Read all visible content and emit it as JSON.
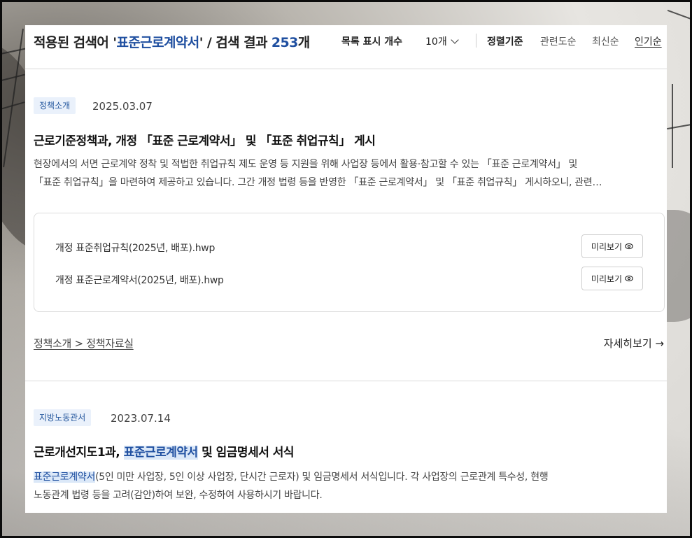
{
  "header": {
    "title_prefix": "적용된 검색어 '",
    "keyword": "표준근로계약서",
    "title_mid": "' / 검색 결과 ",
    "result_count": "253",
    "count_unit": "개",
    "list_count_label": "목록 표시 개수",
    "list_count_value": "10개",
    "sort_label": "정렬기준",
    "sort_options": [
      "관련도순",
      "최신순",
      "인기순"
    ],
    "active_sort": "인기순"
  },
  "results": [
    {
      "category": "정책소개",
      "date": "2025.03.07",
      "title": "근로기준정책과, 개정 「표준 근로계약서」 및 「표준 취업규칙」 게시",
      "summary_line1": "현장에서의 서면 근로계약 정착 및 적법한 취업규칙 제도 운영 등 지원을 위해 사업장 등에서 활용·참고할 수 있는 「표준 근로계약서」 및",
      "summary_line2": "「표준 취업규칙」을 마련하여 제공하고 있습니다. 그간 개정 법령 등을 반영한 「표준 근로계약서」 및 「표준 취업규칙」 게시하오니, 관련…",
      "attachments": [
        {
          "name": "개정 표준취업규칙(2025년, 배포).hwp",
          "button": "미리보기"
        },
        {
          "name": "개정 표준근로계약서(2025년, 배포).hwp",
          "button": "미리보기"
        }
      ],
      "breadcrumb": "정책소개 > 정책자료실",
      "more": "자세히보기 →"
    },
    {
      "category": "지방노동관서",
      "date": "2023.07.14",
      "title_prefix": "근로개선지도1과, ",
      "title_highlight": "표준근로계약서",
      "title_suffix": " 및 임금명세서 서식",
      "summary_highlight": "표준근로계약서",
      "summary_line1_rest": "(5인 미만 사업장, 5인 이상 사업장, 단시간 근로자) 및 임금명세서 서식입니다. 각 사업장의 근로관계 특수성, 현행",
      "summary_line2": "노동관계 법령 등을 고려(감안)하여 보완, 수정하여 사용하시기 바랍니다."
    }
  ]
}
